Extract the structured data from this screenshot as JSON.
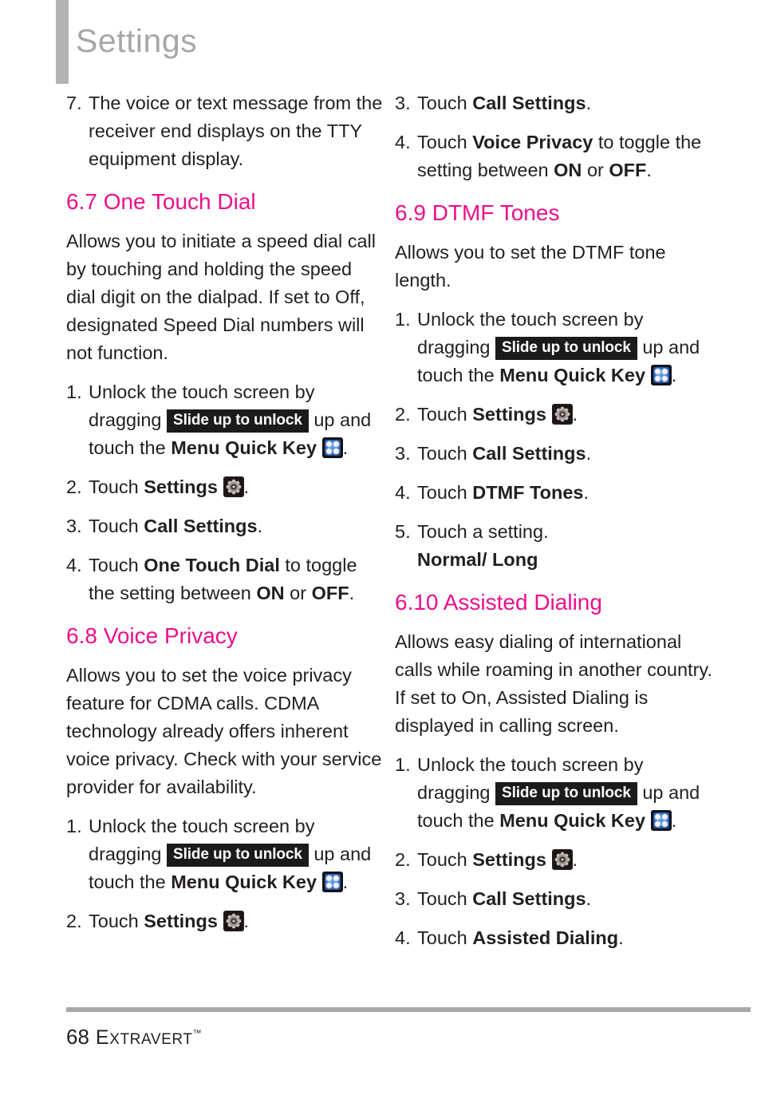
{
  "header": {
    "title": "Settings"
  },
  "icons": {
    "menu_quick_key": "menu-quick-key-icon",
    "settings_gear": "settings-gear-icon"
  },
  "badges": {
    "slide_up_to_unlock": "Slide up to unlock"
  },
  "common": {
    "unlock_step_a": "Unlock the touch screen by dragging",
    "unlock_step_b": "up and touch the",
    "menu_quick_key_label": "Menu Quick Key",
    "period": ".",
    "touch": "Touch",
    "settings_label": "Settings",
    "call_settings_label": "Call Settings"
  },
  "left_column": {
    "item7": {
      "num": "7.",
      "text": "The voice or text message from the receiver end displays on the TTY equipment display."
    },
    "section_6_7": {
      "heading": "6.7 One Touch Dial",
      "body": "Allows you to initiate a speed dial call by touching and holding the speed dial digit on the dialpad. If set to Off, designated Speed Dial numbers will not function.",
      "steps": [
        {
          "num": "1.",
          "kind": "unlock"
        },
        {
          "num": "2.",
          "kind": "settings"
        },
        {
          "num": "3.",
          "kind": "call_settings"
        },
        {
          "num": "4.",
          "kind": "toggle",
          "pre": "Touch",
          "bold": "One Touch Dial",
          "mid": "to toggle the setting between",
          "on": "ON",
          "or": "or",
          "off": "OFF",
          "end": "."
        }
      ]
    },
    "section_6_8": {
      "heading": "6.8 Voice Privacy",
      "body": "Allows you to set the voice privacy feature for CDMA calls. CDMA technology already offers inherent voice privacy. Check with your service provider for availability.",
      "steps": [
        {
          "num": "1.",
          "kind": "unlock"
        },
        {
          "num": "2.",
          "kind": "settings"
        }
      ]
    }
  },
  "right_column": {
    "continued_steps": [
      {
        "num": "3.",
        "kind": "call_settings"
      },
      {
        "num": "4.",
        "kind": "toggle",
        "pre": "Touch",
        "bold": "Voice Privacy",
        "mid": "to toggle the setting between",
        "on": "ON",
        "or": "or",
        "off": "OFF",
        "end": "."
      }
    ],
    "section_6_9": {
      "heading": "6.9 DTMF Tones",
      "body": "Allows you to set the DTMF tone length.",
      "steps": [
        {
          "num": "1.",
          "kind": "unlock"
        },
        {
          "num": "2.",
          "kind": "settings"
        },
        {
          "num": "3.",
          "kind": "call_settings"
        },
        {
          "num": "4.",
          "kind": "simple",
          "pre": "Touch",
          "bold": "DTMF Tones",
          "end": "."
        },
        {
          "num": "5.",
          "kind": "setting_choice",
          "text": "Touch a setting.",
          "options": "Normal/ Long"
        }
      ]
    },
    "section_6_10": {
      "heading": "6.10 Assisted Dialing",
      "body": "Allows easy dialing of international calls while roaming in another country. If set to On, Assisted Dialing is displayed in calling screen.",
      "steps": [
        {
          "num": "1.",
          "kind": "unlock"
        },
        {
          "num": "2.",
          "kind": "settings"
        },
        {
          "num": "3.",
          "kind": "call_settings"
        },
        {
          "num": "4.",
          "kind": "simple",
          "pre": "Touch",
          "bold": "Assisted Dialing",
          "end": "."
        }
      ]
    }
  },
  "footer": {
    "page_number": "68",
    "brand_e": "E",
    "brand_rest": "XTRAVERT",
    "trademark": "™"
  },
  "colors": {
    "heading_pink": "#ec0f8c",
    "header_gray": "#a7a7a7",
    "bar_gray": "#b3b3b3",
    "body_text": "#231f20",
    "badge_bg": "#1b1b1b"
  }
}
